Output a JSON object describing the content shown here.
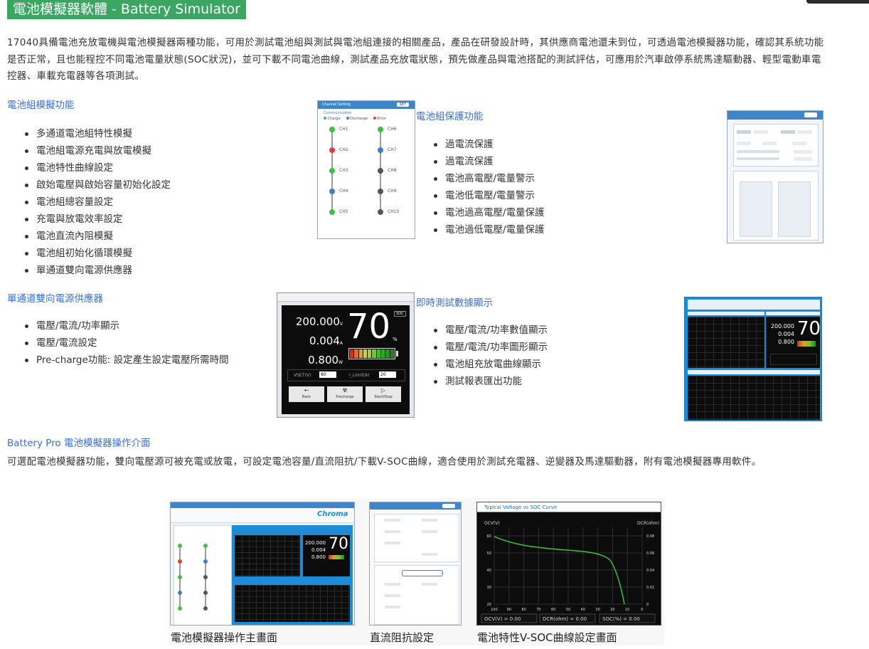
{
  "page": {
    "title": "電池模擬器軟體 - Battery Simulator",
    "intro": "17040具備電池充放電機與電池模擬器兩種功能，可用於測試電池組與測試與電池組連接的相關產品，產品在研發設計時，其供應商電池還未到位，可透過電池模擬器功能，確認其系統功能是否正常，且也能程控不同電池電量狀態(SOC狀況)，並可下載不同電池曲線，測試產品充放電狀態，預先做產品與電池搭配的測試評估，可應用於汽車啟停系統馬達驅動器、輕型電動車電控器、車載充電器等各項測試。"
  },
  "sections": {
    "battery_pack": {
      "heading": "電池組模擬功能",
      "items": [
        "多通道電池組特性模擬",
        "電池組電源充電與放電模擬",
        "電池特性曲線設定",
        "啟始電壓與啟始容量初始化設定",
        "電池組總容量設定",
        "充電與放電效率設定",
        "電池直流內阻模擬",
        "電池組初始化循環模擬",
        "單通道雙向電源供應器"
      ]
    },
    "protection": {
      "heading": "電池組保護功能",
      "items": [
        "過電流保護",
        "過電流保護",
        "電池高電壓/電量警示",
        "電池低電壓/電量警示",
        "電池過高電壓/電量保護",
        "電池過低電壓/電量保護"
      ]
    },
    "bidirectional": {
      "heading": "單通道雙向電源供應器",
      "items": [
        "電壓/電流/功率顯示",
        "電壓/電流設定",
        "Pre-charge功能: 設定產生設定電壓所需時間"
      ]
    },
    "realtime": {
      "heading": "即時測試數據顯示",
      "items": [
        "電壓/電流/功率數值顯示",
        "電壓/電流/功率圖形顯示",
        "電池組充放電曲線顯示",
        "測試報表匯出功能"
      ]
    },
    "battery_pro": {
      "heading": "Battery Pro 電池模擬器操作介面",
      "text": "可選配電池模擬器功能，雙向電壓源可被充電或放電，可設定電池容量/直流阻抗/下載V-SOC曲線，適合使用於測試充電器、逆變器及馬達驅動器，附有電池模擬器專用軟件。"
    }
  },
  "screenshots": {
    "channel_setting": {
      "title": "Channel Setting",
      "button": "SET",
      "subtitle": "Communication",
      "legend": [
        "Charge",
        "Discharge",
        "Error"
      ],
      "left_channels": [
        "CH1",
        "CH2",
        "CH3",
        "CH4",
        "CH5"
      ],
      "right_channels": [
        "CH6",
        "CH7",
        "CH8",
        "CH9",
        "CH10"
      ],
      "left_colors": [
        "#3fbf3f",
        "#e0403a",
        "#3fbf3f",
        "#3d7fc8",
        "#3fbf3f"
      ],
      "right_colors": [
        "#3fbf3f",
        "#3d7fc8",
        "#555555",
        "#555555",
        "#555555"
      ]
    },
    "power_display": {
      "voltage": "200.000",
      "current": "0.004",
      "power": "0.800",
      "soc": "70",
      "soc_tag": "SOC",
      "soc_unit": "%",
      "v_unit": "V",
      "a_unit": "A",
      "w_unit": "W",
      "vset_label": "VSET(V)",
      "vset_value": "80",
      "limit_label": "I_Limit(A)",
      "limit_value": "20",
      "buttons": [
        "Back",
        "Precharge",
        "Start/Stop"
      ],
      "battery_cells": [
        "#c83030",
        "#e07020",
        "#e0a020",
        "#d4d420",
        "#a8d420",
        "#70c830",
        "#40b830",
        "#30a830",
        "#209820",
        "#208820"
      ]
    },
    "vsoc_curve": {
      "title": "Typical Voltage vs SOC Curve",
      "left_axis": "OCV(V)",
      "right_axis": "DCR(ohm)",
      "y_ticks": [
        "60",
        "50",
        "40",
        "30",
        "20"
      ],
      "right_ticks": [
        "0.08",
        "0.06",
        "0.04",
        "0.02",
        "0"
      ],
      "x_ticks": [
        "100",
        "90",
        "80",
        "70",
        "60",
        "50",
        "40",
        "30",
        "20",
        "10",
        "0"
      ],
      "readouts": [
        "OCV(V) = 0.00",
        "DCR(ohm) = 0.00",
        "SOC(%) = 0.00"
      ]
    }
  },
  "captions": {
    "main_screen": "電池模擬器操作主畫面",
    "dcr_setting": "直流阻抗設定",
    "vsoc_setting": "電池特性V-SOC曲線設定畫面"
  },
  "colors": {
    "title_bg": "#3aa662",
    "link": "#3a6fd6",
    "screen_dark": "#0c0c0c",
    "chroma_blue": "#1d8bd6"
  }
}
